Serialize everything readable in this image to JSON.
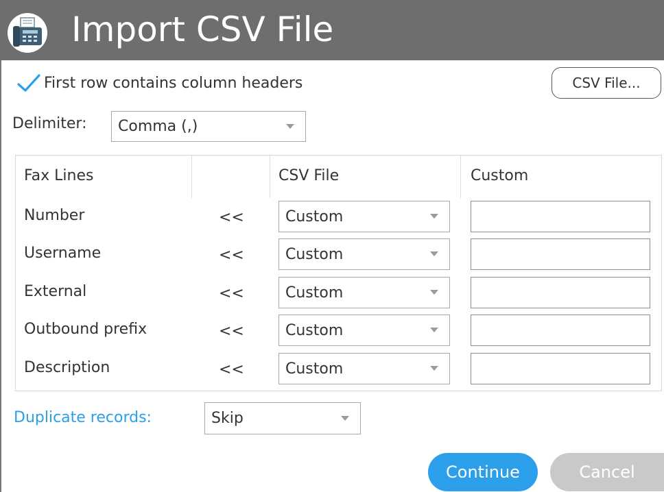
{
  "dialog": {
    "title": "Import CSV File",
    "icon": "fax-machine-icon"
  },
  "options": {
    "first_row_headers_label": "First row contains column headers",
    "first_row_headers_checked": true,
    "csv_file_button": "CSV File...",
    "delimiter_label": "Delimiter:",
    "delimiter_value": "Comma (,)"
  },
  "mapping": {
    "headers": [
      "Fax Lines",
      "CSV File",
      "Custom"
    ],
    "arrow_text": "<<",
    "rows": [
      {
        "field": "Number",
        "source": "Custom",
        "custom": ""
      },
      {
        "field": "Username",
        "source": "Custom",
        "custom": ""
      },
      {
        "field": "External",
        "source": "Custom",
        "custom": ""
      },
      {
        "field": "Outbound prefix",
        "source": "Custom",
        "custom": ""
      },
      {
        "field": "Description",
        "source": "Custom",
        "custom": ""
      }
    ]
  },
  "duplicates": {
    "label": "Duplicate records:",
    "value": "Skip"
  },
  "actions": {
    "continue_label": "Continue",
    "cancel_label": "Cancel",
    "cancel_enabled": false
  },
  "colors": {
    "titlebar": "#6e6e6e",
    "accent": "#2b9fea",
    "disabled": "#c9c9c9"
  }
}
